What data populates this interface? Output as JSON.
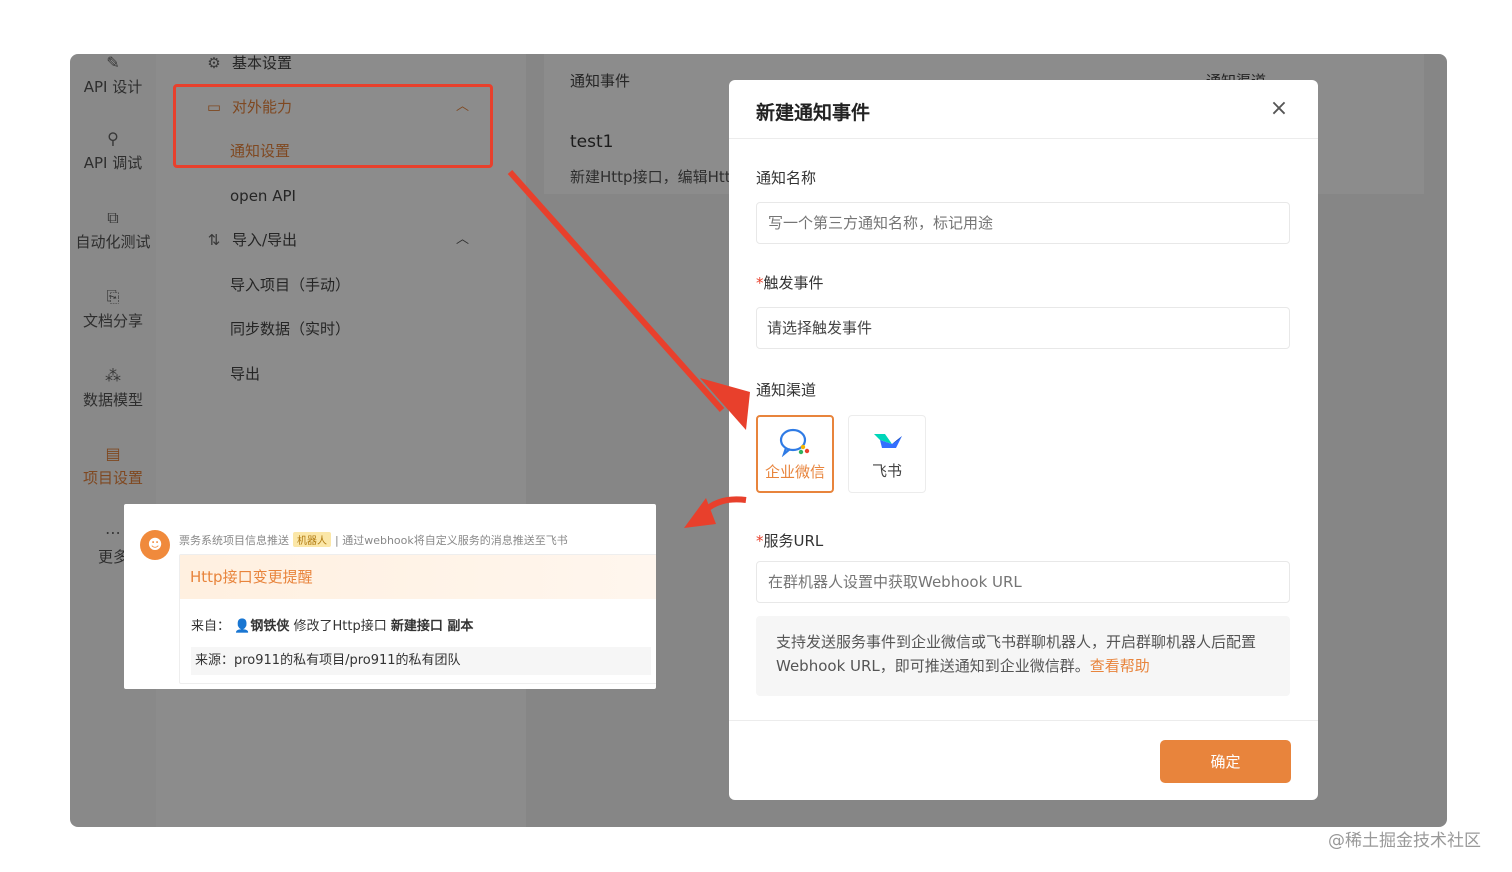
{
  "rail": {
    "items": [
      {
        "label": "API 设计",
        "icon": "edit-icon"
      },
      {
        "label": "API 调试",
        "icon": "rocket-icon"
      },
      {
        "label": "自动化测试",
        "icon": "flow-icon"
      },
      {
        "label": "文档分享",
        "icon": "doc-share-icon"
      },
      {
        "label": "数据模型",
        "icon": "model-icon"
      },
      {
        "label": "项目设置",
        "icon": "project-settings-icon"
      },
      {
        "label": "更多",
        "icon": "more-icon"
      }
    ]
  },
  "menu": {
    "basic_settings": "基本设置",
    "external": "对外能力",
    "notify_settings": "通知设置",
    "open_api": "open API",
    "import_export": "导入/导出",
    "import_manual": "导入项目（手动）",
    "sync_data": "同步数据（实时）",
    "export": "导出"
  },
  "content": {
    "col_event": "通知事件",
    "col_channel": "通知渠道",
    "row_title": "test1",
    "row_desc": "新建Http接口，编辑Http"
  },
  "modal": {
    "title": "新建通知事件",
    "close": "×",
    "name_label": "通知名称",
    "name_placeholder": "写一个第三方通知名称，标记用途",
    "trigger_req": "*",
    "trigger_label": "触发事件",
    "trigger_placeholder": "请选择触发事件",
    "channel_label": "通知渠道",
    "channels": [
      {
        "label": "企业微信",
        "selected": true,
        "icon": "wecom-icon"
      },
      {
        "label": "飞书",
        "selected": false,
        "icon": "feishu-icon"
      }
    ],
    "url_req": "*",
    "url_label": "服务URL",
    "url_placeholder": "在群机器人设置中获取Webhook URL",
    "help_text": "支持发送服务事件到企业微信或飞书群聊机器人，开启群聊机器人后配置Webhook URL，即可推送通知到企业微信群。",
    "help_link": "查看帮助",
    "confirm": "确定"
  },
  "preview": {
    "sender": "票务系统项目信息推送",
    "tag": "机器人",
    "separator": "|",
    "desc": "通过webhook将自定义服务的消息推送至飞书",
    "title": "Http接口变更提醒",
    "from_label": "来自：",
    "user": "钢铁侠",
    "action": "修改了Http接口",
    "target": "新建接口 副本",
    "source": "来源：pro911的私有项目/pro911的私有团队"
  },
  "watermark": "@稀土掘金技术社区",
  "colors": {
    "accent": "#e8843c",
    "annotation_red": "#e8402c"
  }
}
